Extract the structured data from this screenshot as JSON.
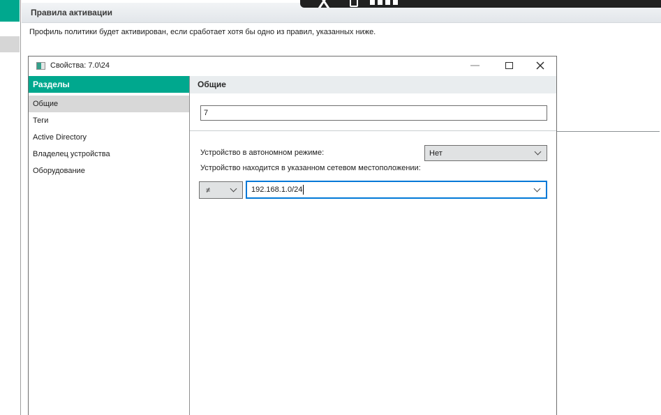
{
  "page": {
    "title": "Правила активации",
    "description": "Профиль политики будет активирован, если сработает хотя бы одно из правил, указанных ниже."
  },
  "toolbar_fragment": {
    "icons": [
      "x-icon",
      "clipboard-icon",
      "chart-bars-icon"
    ]
  },
  "dialog": {
    "title": "Свойства: 7.0\\24",
    "sidebar": {
      "header": "Разделы",
      "items": [
        {
          "label": "Общие"
        },
        {
          "label": "Теги"
        },
        {
          "label": "Active Directory"
        },
        {
          "label": "Владелец устройства"
        },
        {
          "label": "Оборудование"
        }
      ],
      "selected_index": 0
    },
    "main": {
      "header": "Общие",
      "rule_name_value": "7",
      "offline_label": "Устройство в автономном режиме:",
      "offline_value": "Нет",
      "network_label": "Устройство находится в указанном сетевом местоположении:",
      "network_operator": "≠",
      "network_value": "192.168.1.0/24"
    }
  },
  "colors": {
    "accent_teal": "#00a88e",
    "focus_blue": "#0078d7"
  }
}
